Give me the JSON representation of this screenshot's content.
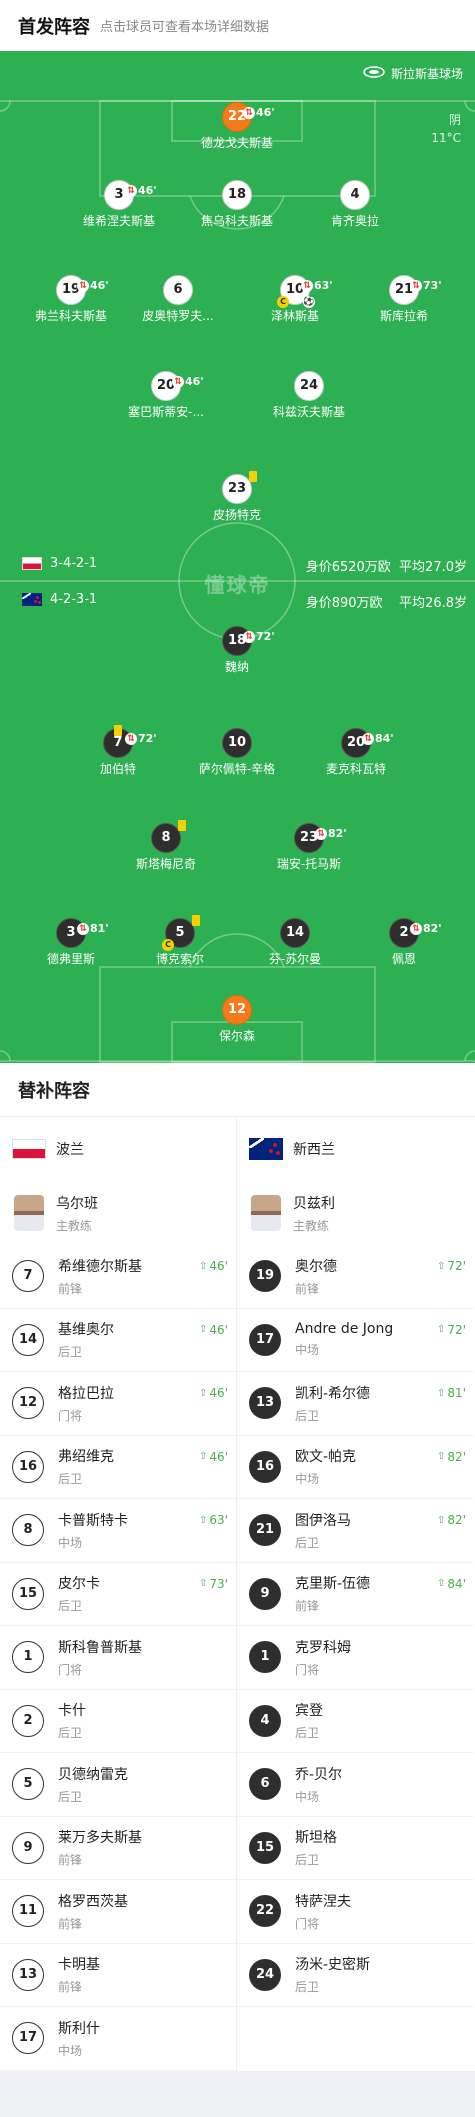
{
  "header": {
    "title": "首发阵容",
    "hint": "点击球员可查看本场详细数据"
  },
  "pitch": {
    "stadium": "斯拉斯基球场",
    "weather": "阴",
    "temperature": "11°C",
    "watermark": "懂球帝"
  },
  "home": {
    "formation": "3-4-2-1",
    "value": "身价6520万欧",
    "age": "平均27.0岁"
  },
  "away": {
    "formation": "4-2-3-1",
    "value": "身价890万欧",
    "age": "平均26.8岁"
  },
  "players_home": [
    {
      "num": "22",
      "name": "德龙戈夫斯基",
      "sub": "46'"
    },
    {
      "num": "3",
      "name": "维希涅夫斯基",
      "sub": "46'"
    },
    {
      "num": "18",
      "name": "焦乌科夫斯基"
    },
    {
      "num": "4",
      "name": "肯齐奥拉"
    },
    {
      "num": "19",
      "name": "弗兰科夫斯基",
      "sub": "46'"
    },
    {
      "num": "6",
      "name": "皮奥特罗夫..."
    },
    {
      "num": "10",
      "name": "泽林斯基",
      "sub": "63'"
    },
    {
      "num": "21",
      "name": "斯库拉希",
      "sub": "73'"
    },
    {
      "num": "20",
      "name": "塞巴斯蒂安-...",
      "sub": "46'"
    },
    {
      "num": "24",
      "name": "科兹沃夫斯基"
    },
    {
      "num": "23",
      "name": "皮扬特克"
    }
  ],
  "players_away": [
    {
      "num": "18",
      "name": "魏纳",
      "sub": "72'"
    },
    {
      "num": "7",
      "name": "加伯特",
      "sub": "72'"
    },
    {
      "num": "10",
      "name": "萨尔佩特-辛格"
    },
    {
      "num": "20",
      "name": "麦克科瓦特",
      "sub": "84'"
    },
    {
      "num": "8",
      "name": "斯塔梅尼奇"
    },
    {
      "num": "23",
      "name": "瑞安-托马斯",
      "sub": "82'"
    },
    {
      "num": "3",
      "name": "德弗里斯",
      "sub": "81'"
    },
    {
      "num": "5",
      "name": "博克索尔"
    },
    {
      "num": "14",
      "name": "芬-苏尔曼"
    },
    {
      "num": "2",
      "name": "佩恩",
      "sub": "82'"
    },
    {
      "num": "12",
      "name": "保尔森"
    }
  ],
  "subs": {
    "title": "替补阵容",
    "home_team": "波兰",
    "away_team": "新西兰",
    "home_coach": {
      "name": "乌尔班",
      "role": "主教练"
    },
    "away_coach": {
      "name": "贝兹利",
      "role": "主教练"
    },
    "home": [
      {
        "num": "7",
        "name": "希维德尔斯基",
        "pos": "前锋",
        "time": "46'"
      },
      {
        "num": "14",
        "name": "基维奥尔",
        "pos": "后卫",
        "time": "46'"
      },
      {
        "num": "12",
        "name": "格拉巴拉",
        "pos": "门将",
        "time": "46'"
      },
      {
        "num": "16",
        "name": "弗绍维克",
        "pos": "后卫",
        "time": "46'"
      },
      {
        "num": "8",
        "name": "卡普斯特卡",
        "pos": "中场",
        "time": "63'"
      },
      {
        "num": "15",
        "name": "皮尔卡",
        "pos": "后卫",
        "time": "73'"
      },
      {
        "num": "1",
        "name": "斯科鲁普斯基",
        "pos": "门将"
      },
      {
        "num": "2",
        "name": "卡什",
        "pos": "后卫"
      },
      {
        "num": "5",
        "name": "贝德纳雷克",
        "pos": "后卫"
      },
      {
        "num": "9",
        "name": "莱万多夫斯基",
        "pos": "前锋"
      },
      {
        "num": "11",
        "name": "格罗西茨基",
        "pos": "前锋"
      },
      {
        "num": "13",
        "name": "卡明基",
        "pos": "前锋"
      },
      {
        "num": "17",
        "name": "斯利什",
        "pos": "中场"
      }
    ],
    "away": [
      {
        "num": "19",
        "name": "奥尔德",
        "pos": "前锋",
        "time": "72'"
      },
      {
        "num": "17",
        "name": "Andre de Jong",
        "pos": "中场",
        "time": "72'"
      },
      {
        "num": "13",
        "name": "凯利-希尔德",
        "pos": "后卫",
        "time": "81'"
      },
      {
        "num": "16",
        "name": "欧文-帕克",
        "pos": "中场",
        "time": "82'"
      },
      {
        "num": "21",
        "name": "图伊洛马",
        "pos": "后卫",
        "time": "82'"
      },
      {
        "num": "9",
        "name": "克里斯-伍德",
        "pos": "前锋",
        "time": "84'"
      },
      {
        "num": "1",
        "name": "克罗科姆",
        "pos": "门将"
      },
      {
        "num": "4",
        "name": "宾登",
        "pos": "后卫"
      },
      {
        "num": "6",
        "name": "乔-贝尔",
        "pos": "中场"
      },
      {
        "num": "15",
        "name": "斯坦格",
        "pos": "后卫"
      },
      {
        "num": "22",
        "name": "特萨涅夫",
        "pos": "门将"
      },
      {
        "num": "24",
        "name": "汤米-史密斯",
        "pos": "后卫"
      }
    ]
  }
}
